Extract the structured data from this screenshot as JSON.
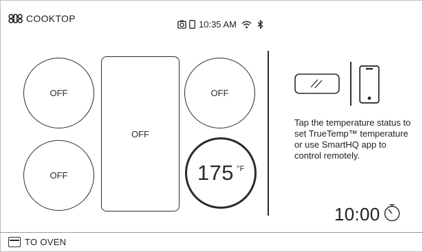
{
  "header": {
    "title": "COOKTOP",
    "time": "10:35 AM"
  },
  "burners": {
    "left_top": "OFF",
    "left_bottom": "OFF",
    "center_bridge": "OFF",
    "right_top": "OFF",
    "right_bottom": {
      "value": "175",
      "unit": "°F"
    }
  },
  "info": {
    "hint": "Tap the temperature status to set TrueTemp™ temperature or use SmartHQ app to control remotely."
  },
  "timer": {
    "value": "10:00"
  },
  "footer": {
    "label": "TO OVEN"
  },
  "icons": {
    "brand": "cooktop-burners-icon",
    "camera": "camera-icon",
    "phone_small": "phone-status-icon",
    "wifi": "wifi-icon",
    "bluetooth": "bluetooth-icon",
    "pan": "pan-icon",
    "phone": "smartphone-icon",
    "timer": "stopwatch-icon",
    "oven": "oven-icon"
  },
  "colors": {
    "ink": "#2a2a2a",
    "background": "#ffffff"
  }
}
